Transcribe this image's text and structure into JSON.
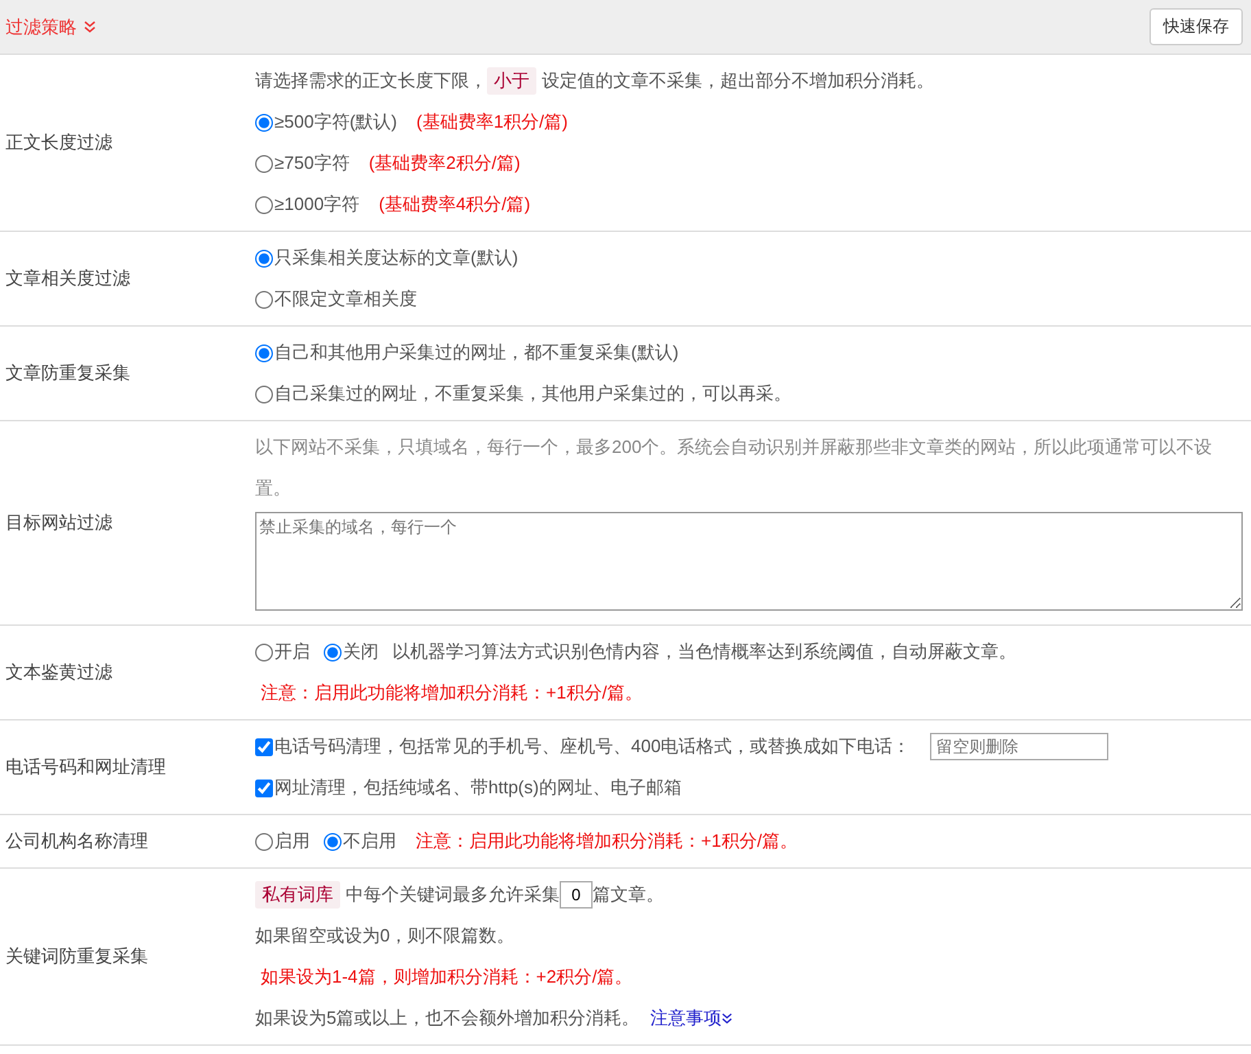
{
  "header": {
    "title": "过滤策略",
    "save_button": "快速保存"
  },
  "rows": [
    {
      "label": "正文长度过滤",
      "lines": [
        [
          {
            "kind": "text",
            "text": "请选择需求的正文长度下限，"
          },
          {
            "kind": "tag",
            "text": "小于"
          },
          {
            "kind": "text",
            "text": "设定值的文章不采集，超出部分不增加积分消耗。"
          }
        ],
        [
          {
            "kind": "radio",
            "label": "≥500字符(默认)",
            "selected": true
          },
          {
            "kind": "note",
            "text": "(基础费率1积分/篇)"
          }
        ],
        [
          {
            "kind": "radio",
            "label": "≥750字符",
            "selected": false
          },
          {
            "kind": "note",
            "text": "(基础费率2积分/篇)"
          }
        ],
        [
          {
            "kind": "radio",
            "label": "≥1000字符",
            "selected": false
          },
          {
            "kind": "note",
            "text": "(基础费率4积分/篇)"
          }
        ]
      ]
    },
    {
      "label": "文章相关度过滤",
      "lines": [
        [
          {
            "kind": "radio",
            "label": "只采集相关度达标的文章(默认)",
            "selected": true
          }
        ],
        [
          {
            "kind": "radio",
            "label": "不限定文章相关度",
            "selected": false
          }
        ]
      ]
    },
    {
      "label": "文章防重复采集",
      "lines": [
        [
          {
            "kind": "radio",
            "label": "自己和其他用户采集过的网址，都不重复采集(默认)",
            "selected": true
          }
        ],
        [
          {
            "kind": "radio",
            "label": "自己采集过的网址，不重复采集，其他用户采集过的，可以再采。",
            "selected": false
          }
        ]
      ]
    },
    {
      "label": "目标网站过滤",
      "lines": [
        [
          {
            "kind": "hint",
            "text": "以下网站不采集，只填域名，每行一个，最多200个。系统会自动识别并屏蔽那些非文章类的网站，所以此项通常可以不设置。"
          }
        ],
        [
          {
            "kind": "textarea",
            "placeholder": "禁止采集的域名，每行一个"
          }
        ]
      ]
    },
    {
      "label": "文本鉴黄过滤",
      "lines": [
        [
          {
            "kind": "radio",
            "label": "开启",
            "selected": false
          },
          {
            "kind": "radio",
            "label": "关闭",
            "selected": true
          },
          {
            "kind": "text",
            "text": "以机器学习算法方式识别色情内容，当色情概率达到系统阈值，自动屏蔽文章。"
          }
        ],
        [
          {
            "kind": "note",
            "text": "注意：启用此功能将增加积分消耗：+1积分/篇。"
          }
        ]
      ]
    },
    {
      "label": "电话号码和网址清理",
      "lines": [
        [
          {
            "kind": "checkbox",
            "label": "电话号码清理，包括常见的手机号、座机号、400电话格式，或替换成如下电话：",
            "checked": true
          },
          {
            "kind": "input",
            "placeholder": "留空则删除"
          }
        ],
        [
          {
            "kind": "checkbox",
            "label": "网址清理，包括纯域名、带http(s)的网址、电子邮箱",
            "checked": true
          }
        ]
      ]
    },
    {
      "label": "公司机构名称清理",
      "lines": [
        [
          {
            "kind": "radio",
            "label": "启用",
            "selected": false
          },
          {
            "kind": "radio",
            "label": "不启用",
            "selected": true
          },
          {
            "kind": "note",
            "text": "注意：启用此功能将增加积分消耗：+1积分/篇。"
          }
        ]
      ]
    },
    {
      "label": "关键词防重复采集",
      "lines": [
        [
          {
            "kind": "tag",
            "text": "私有词库"
          },
          {
            "kind": "text",
            "text": "中每个关键词最多允许采集"
          },
          {
            "kind": "number",
            "value": "0"
          },
          {
            "kind": "text",
            "text": "篇文章。"
          }
        ],
        [
          {
            "kind": "text",
            "text": "如果留空或设为0，则不限篇数。"
          }
        ],
        [
          {
            "kind": "note",
            "text": "如果设为1-4篇，则增加积分消耗：+2积分/篇。"
          }
        ],
        [
          {
            "kind": "text",
            "text": "如果设为5篇或以上，也不会额外增加积分消耗。"
          },
          {
            "kind": "link",
            "text": "注意事项"
          }
        ]
      ]
    }
  ]
}
